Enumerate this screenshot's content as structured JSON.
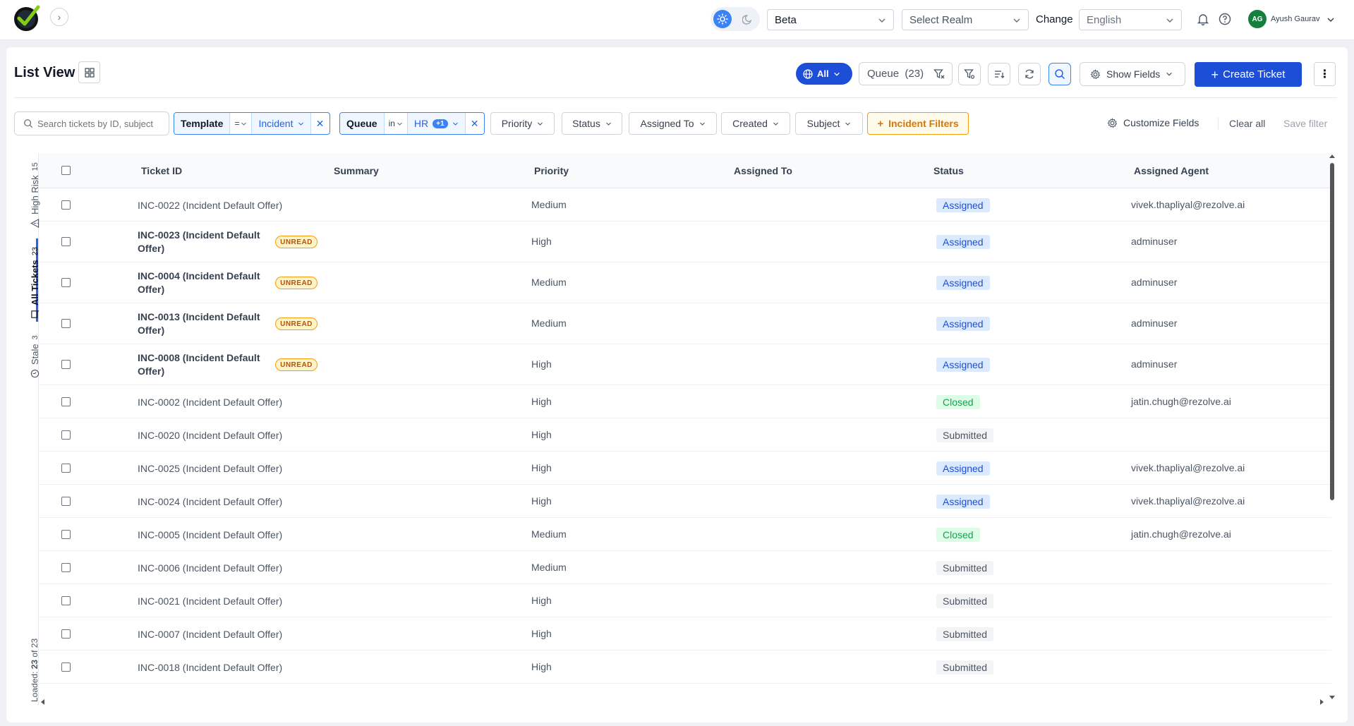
{
  "header": {
    "environment": "Beta",
    "realm_placeholder": "Select Realm",
    "change_label": "Change",
    "language": "English",
    "user_initials": "AG",
    "user_name": "Ayush Gaurav"
  },
  "toolbar": {
    "title": "List View",
    "all_label": "All",
    "queue_label": "Queue",
    "queue_count": "(23)",
    "show_fields_label": "Show Fields",
    "create_ticket_label": "Create Ticket",
    "more_label": "⋮"
  },
  "filters": {
    "search_placeholder": "Search tickets by ID, subject",
    "template_key": "Template",
    "template_op": "=",
    "template_value": "Incident",
    "queue_key": "Queue",
    "queue_op": "in",
    "queue_value": "HR",
    "queue_extra": "+1",
    "priority_label": "Priority",
    "status_label": "Status",
    "assigned_to_label": "Assigned To",
    "created_label": "Created",
    "subject_label": "Subject",
    "incident_filters_label": "Incident Filters",
    "customize_label": "Customize Fields",
    "clear_all_label": "Clear all",
    "save_filter_label": "Save filter"
  },
  "side_tabs": {
    "high_risk_label": "High Risk",
    "high_risk_count": "15",
    "all_tickets_label": "All Tickets",
    "all_tickets_count": "23",
    "stale_label": "Stale",
    "stale_count": "3",
    "loaded_prefix": "Loaded:",
    "loaded_count": "23",
    "loaded_suffix": "of 23"
  },
  "table": {
    "columns": [
      "Ticket ID",
      "Summary",
      "Priority",
      "Assigned To",
      "Status",
      "Assigned Agent"
    ],
    "unread_label": "UNREAD",
    "rows": [
      {
        "id": "INC-0022 (Incident Default Offer)",
        "unread": false,
        "priority": "Medium",
        "status": "Assigned",
        "agent": "vivek.thapliyal@rezolve.ai"
      },
      {
        "id": "INC-0023 (Incident Default Offer)",
        "unread": true,
        "priority": "High",
        "status": "Assigned",
        "agent": "adminuser"
      },
      {
        "id": "INC-0004 (Incident Default Offer)",
        "unread": true,
        "priority": "Medium",
        "status": "Assigned",
        "agent": "adminuser"
      },
      {
        "id": "INC-0013 (Incident Default Offer)",
        "unread": true,
        "priority": "Medium",
        "status": "Assigned",
        "agent": "adminuser"
      },
      {
        "id": "INC-0008 (Incident Default Offer)",
        "unread": true,
        "priority": "High",
        "status": "Assigned",
        "agent": "adminuser"
      },
      {
        "id": "INC-0002 (Incident Default Offer)",
        "unread": false,
        "priority": "High",
        "status": "Closed",
        "agent": "jatin.chugh@rezolve.ai"
      },
      {
        "id": "INC-0020 (Incident Default Offer)",
        "unread": false,
        "priority": "High",
        "status": "Submitted",
        "agent": ""
      },
      {
        "id": "INC-0025 (Incident Default Offer)",
        "unread": false,
        "priority": "High",
        "status": "Assigned",
        "agent": "vivek.thapliyal@rezolve.ai"
      },
      {
        "id": "INC-0024 (Incident Default Offer)",
        "unread": false,
        "priority": "High",
        "status": "Assigned",
        "agent": "vivek.thapliyal@rezolve.ai"
      },
      {
        "id": "INC-0005 (Incident Default Offer)",
        "unread": false,
        "priority": "Medium",
        "status": "Closed",
        "agent": "jatin.chugh@rezolve.ai"
      },
      {
        "id": "INC-0006 (Incident Default Offer)",
        "unread": false,
        "priority": "Medium",
        "status": "Submitted",
        "agent": ""
      },
      {
        "id": "INC-0021 (Incident Default Offer)",
        "unread": false,
        "priority": "High",
        "status": "Submitted",
        "agent": ""
      },
      {
        "id": "INC-0007 (Incident Default Offer)",
        "unread": false,
        "priority": "High",
        "status": "Submitted",
        "agent": ""
      },
      {
        "id": "INC-0018 (Incident Default Offer)",
        "unread": false,
        "priority": "High",
        "status": "Submitted",
        "agent": ""
      }
    ]
  },
  "colors": {
    "primary": "#1d4ed8",
    "accent": "#3b82f6",
    "unread": "#f59e0b",
    "assigned_bg": "#dbeafe",
    "closed_bg": "#dcfce7"
  }
}
